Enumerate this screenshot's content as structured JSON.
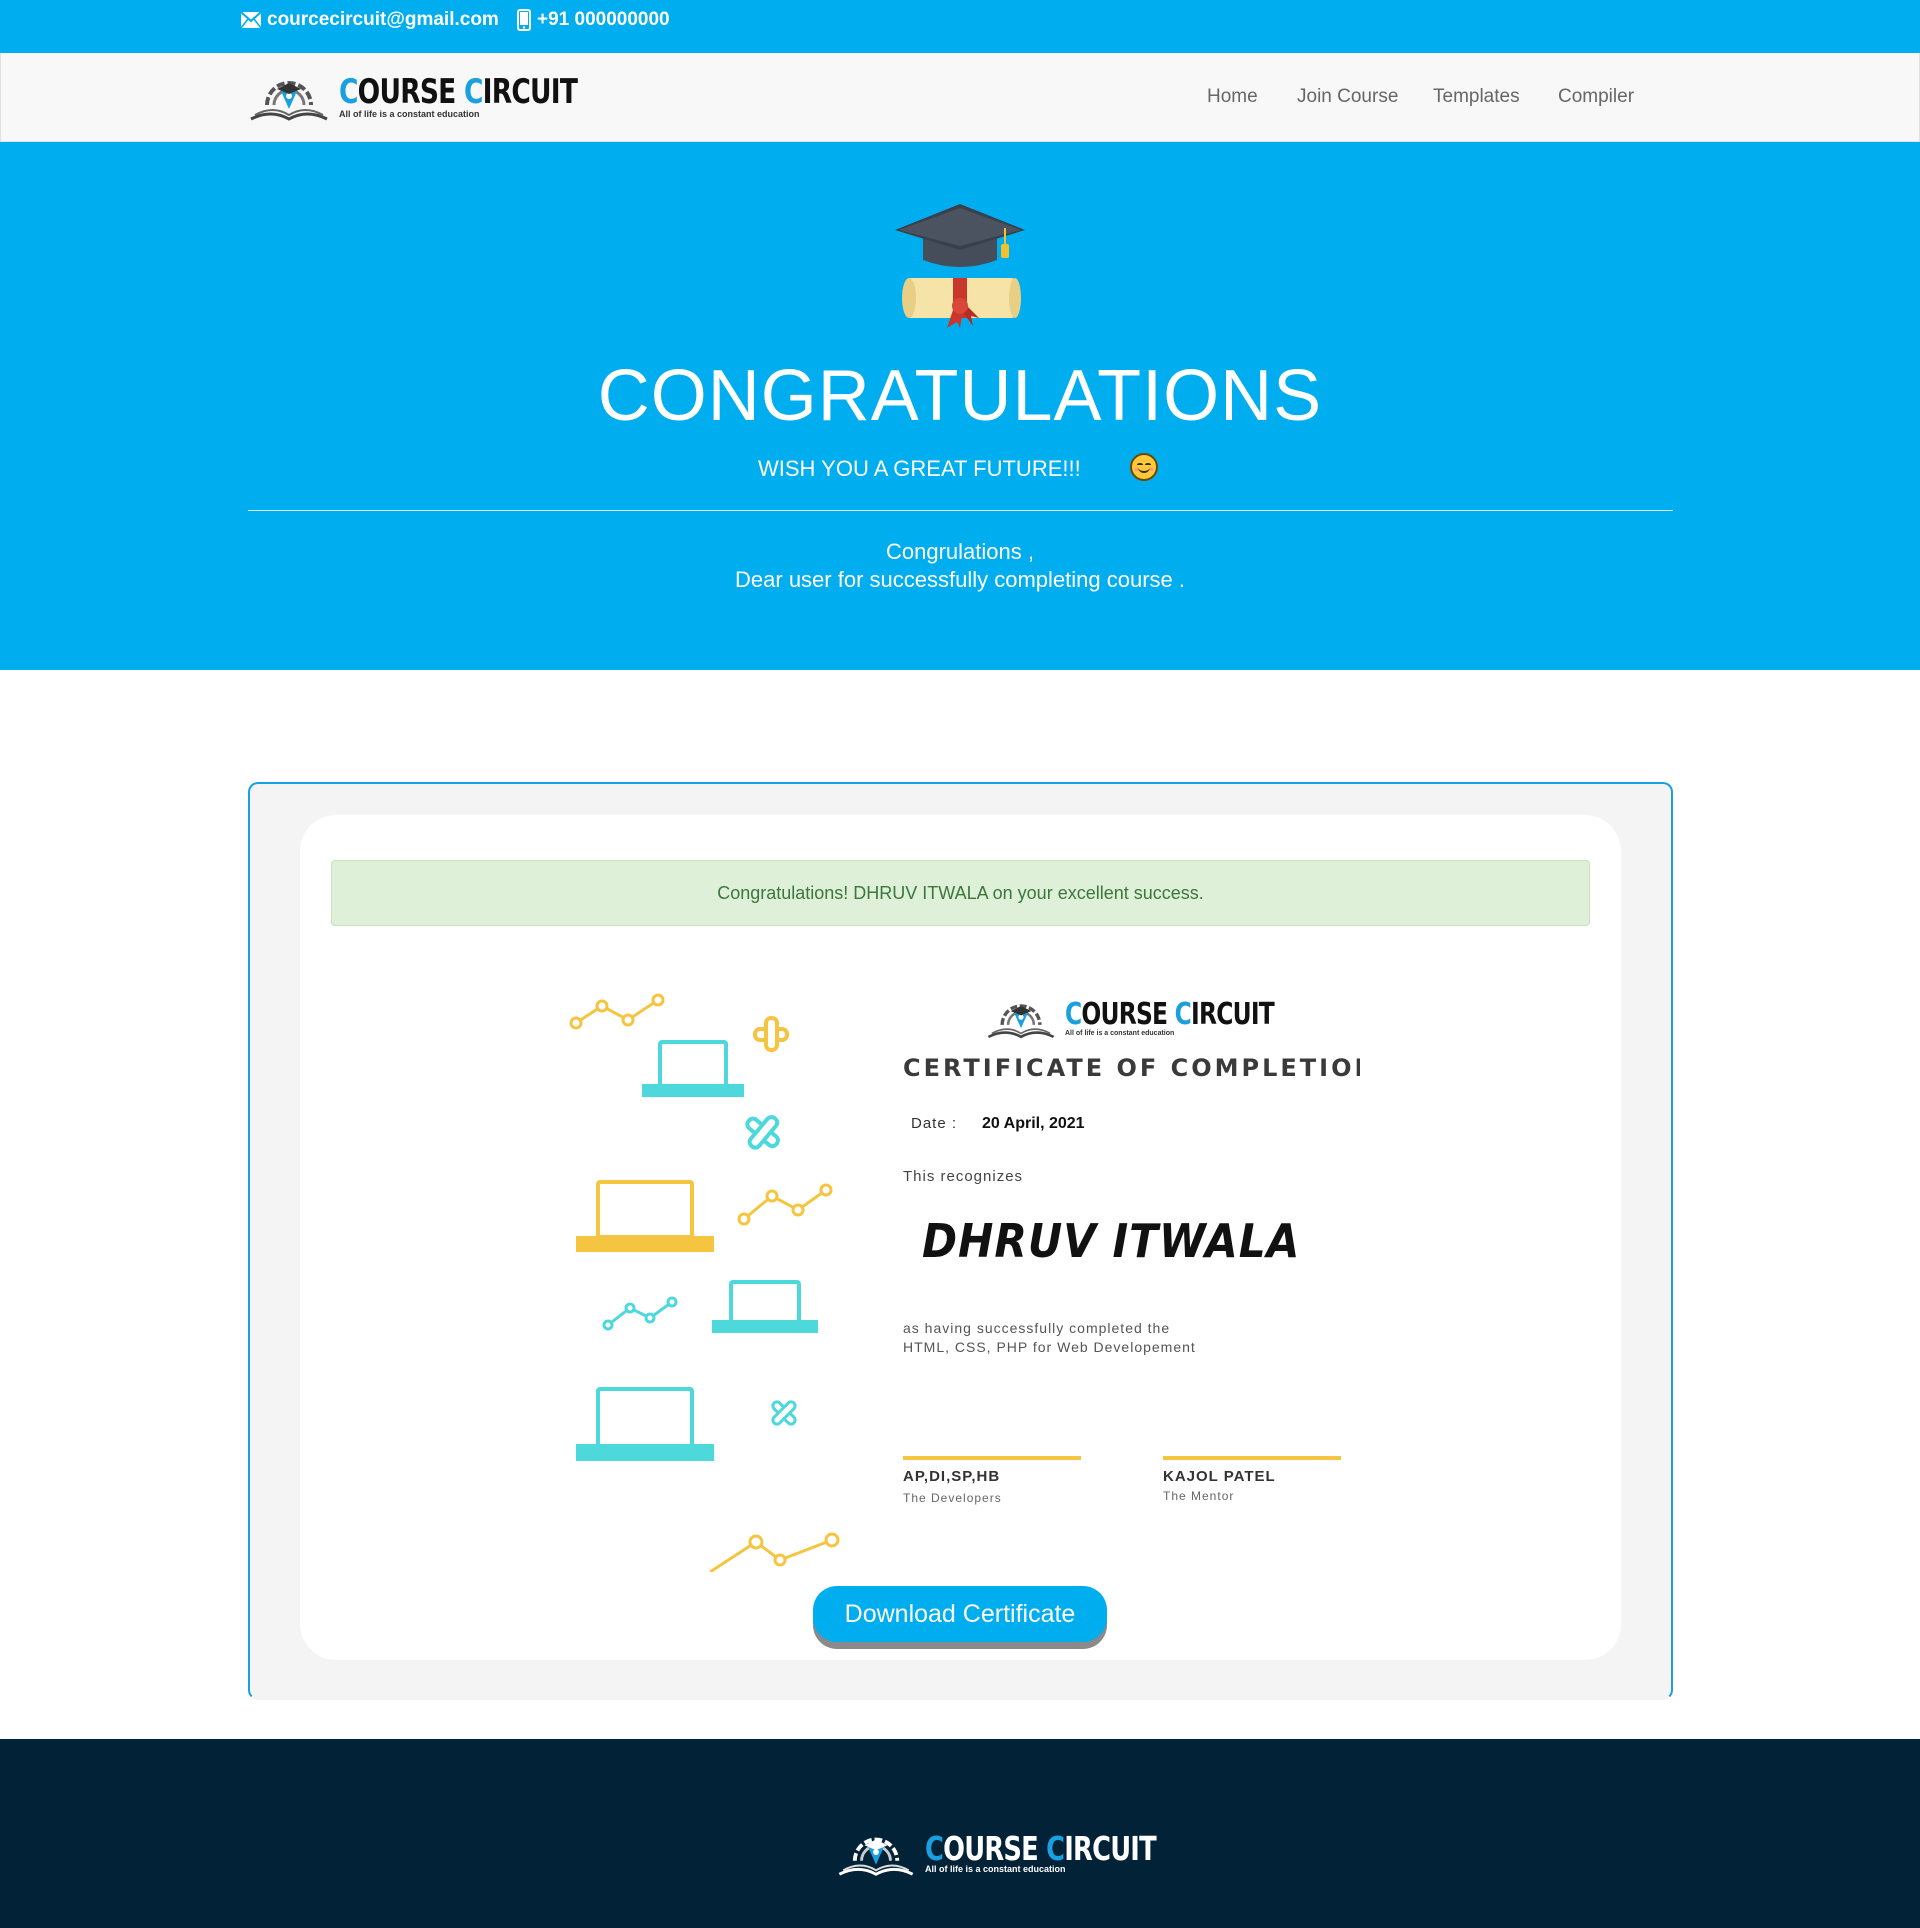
{
  "topbar": {
    "email": "courcecircuit@gmail.com",
    "phone": "+91 000000000",
    "email_icon": "mail-icon",
    "phone_icon": "mobile-phone-icon"
  },
  "brand": {
    "first_cap": "C",
    "first_rest": "OURSE",
    "second_cap": "C",
    "second_rest": "IRCUIT",
    "tagline": "All of life is a constant education"
  },
  "nav": {
    "home": "Home",
    "join_course": "Join Course",
    "templates": "Templates",
    "compiler": "Compiler"
  },
  "hero": {
    "icon": "graduation-cap-diploma-icon",
    "title": "CONGRATULATIONS",
    "subtitle": "WISH YOU A GREAT FUTURE!!!",
    "emoji": "smiling-face-icon",
    "message_line1": "Congrulations ,",
    "message_line2": "Dear user for successfully completing course ."
  },
  "alert": {
    "text": "Congratulations! DHRUV ITWALA on your excellent success."
  },
  "certificate": {
    "title": "CERTIFICATE OF COMPLETION",
    "date_label": "Date :",
    "date": "20 April, 2021",
    "recognizes": "This recognizes",
    "recipient": "DHRUV ITWALA",
    "body_line1": "as having successfully completed the",
    "body_line2": "HTML, CSS, PHP for Web Developement",
    "signer1_name": "AP,DI,SP,HB",
    "signer1_role": "The Developers",
    "signer2_name": "KAJOL PATEL",
    "signer2_role": "The Mentor"
  },
  "download_button": "Download Certificate",
  "colors": {
    "primary": "#00adef",
    "footer": "#012237",
    "alert_bg": "#dff0d8",
    "alert_text": "#3c763d",
    "accent_yellow": "#f5c542",
    "accent_teal": "#4dd8dc"
  }
}
